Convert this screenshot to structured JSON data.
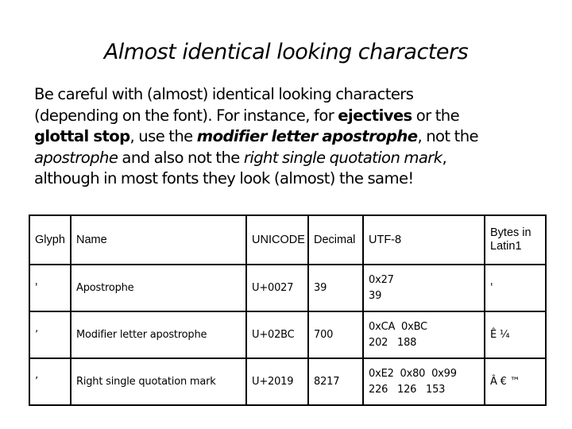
{
  "title": "Almost identical looking characters",
  "paragraph": {
    "line1": "Be careful with (almost) identical looking characters",
    "line2_a": "(depending on the font). For instance, for ",
    "line2_b_bold": "ejectives",
    "line2_c": " or the",
    "line3_a_bold": "glottal stop",
    "line3_b": ", use the ",
    "line3_c_bolditalic": "modifier letter apostrophe",
    "line3_d": ", not the",
    "line4_a_italic": "apostrophe",
    "line4_b": " and also not the ",
    "line4_c_italic": "right single quotation mark",
    "line4_d": ",",
    "line5": "although in most fonts they look (almost) the same!"
  },
  "table": {
    "headers": {
      "glyph": "Glyph",
      "name": "Name",
      "unicode": "UNICODE",
      "decimal": "Decimal",
      "utf8": "UTF-8",
      "latin1": "Bytes in Latin1"
    },
    "rows": [
      {
        "glyph": "'",
        "name": "Apostrophe",
        "unicode": "U+0027",
        "decimal": "39",
        "utf8_hex": "0x27",
        "utf8_dec": "39",
        "latin1": "'"
      },
      {
        "glyph": "ʼ",
        "name": "Modifier letter apostrophe",
        "unicode": "U+02BC",
        "decimal": "700",
        "utf8_hex": "0xCA  0xBC",
        "utf8_dec": "202   188",
        "latin1": "Ê ¼"
      },
      {
        "glyph": "’",
        "name": "Right single quotation mark",
        "unicode": "U+2019",
        "decimal": "8217",
        "utf8_hex": "0xE2  0x80  0x99",
        "utf8_dec": "226   126   153",
        "latin1": "Â € ™"
      }
    ]
  }
}
